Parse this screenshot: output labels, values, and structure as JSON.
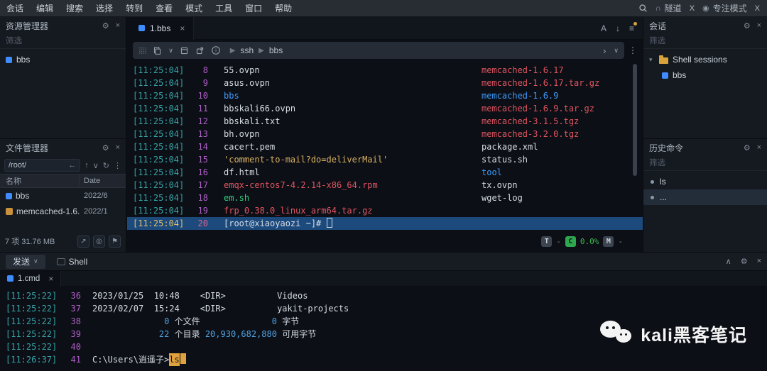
{
  "colors": {
    "accent_blue": "#3f8cff",
    "timestamp": "#36a3a8",
    "line_number": "#b05fc8",
    "file_default": "#d6dde6",
    "directory": "#3f9bfb",
    "archive": "#e05561",
    "executable": "#2fd07a",
    "quoted": "#d9b163",
    "selection_background": "#1d4a7d",
    "selected_timestamp": "#e2c06a",
    "selected_line_number": "#e0608d",
    "cpu_badge_green": "#2ea84f",
    "command_highlight": "#e0a23f",
    "folder_yellow": "#d9a33c"
  },
  "menu_bar": {
    "items": [
      "会话",
      "编辑",
      "搜索",
      "选择",
      "转到",
      "查看",
      "模式",
      "工具",
      "窗口",
      "帮助"
    ],
    "tunnel": {
      "label": "隧道",
      "close": "X"
    },
    "focus_mode": {
      "label": "专注模式",
      "close": "X"
    }
  },
  "left_panel": {
    "explorer": {
      "title": "资源管理器",
      "filter": "筛选",
      "items": [
        {
          "label": "bbs"
        }
      ]
    },
    "file_manager": {
      "title": "文件管理器",
      "path": "/root/",
      "columns": {
        "name": "名称",
        "date": "Date"
      },
      "rows": [
        {
          "name": "bbs",
          "date": "2022/6"
        },
        {
          "name": "memcached-1.6...",
          "date": "2022/1"
        }
      ],
      "status": "7 项 31.76 MB"
    }
  },
  "main": {
    "tab": {
      "label": "1.bbs",
      "close": "×"
    },
    "tab_tools": {
      "font": "A",
      "scroll": "↓",
      "menu": "≡"
    },
    "toolbar": {
      "breadcrumb": [
        "ssh",
        "bbs"
      ]
    },
    "terminal": {
      "lines": [
        {
          "time": "[11:25:04]",
          "num": "8",
          "left": "55.ovpn",
          "right": "memcached-1.6.17"
        },
        {
          "time": "[11:25:04]",
          "num": "9",
          "left": "asus.ovpn",
          "right": "memcached-1.6.17.tar.gz"
        },
        {
          "time": "[11:25:04]",
          "num": "10",
          "left": "bbs",
          "right": "memcached-1.6.9"
        },
        {
          "time": "[11:25:04]",
          "num": "11",
          "left": "bbskali66.ovpn",
          "right": "memcached-1.6.9.tar.gz"
        },
        {
          "time": "[11:25:04]",
          "num": "12",
          "left": "bbskali.txt",
          "right": "memcached-3.1.5.tgz"
        },
        {
          "time": "[11:25:04]",
          "num": "13",
          "left": "bh.ovpn",
          "right": "memcached-3.2.0.tgz"
        },
        {
          "time": "[11:25:04]",
          "num": "14",
          "left": "cacert.pem",
          "right": "package.xml"
        },
        {
          "time": "[11:25:04]",
          "num": "15",
          "left": "'comment-to-mail?do=deliverMail'",
          "right": "status.sh"
        },
        {
          "time": "[11:25:04]",
          "num": "16",
          "left": "df.html",
          "right": "tool"
        },
        {
          "time": "[11:25:04]",
          "num": "17",
          "left": "emqx-centos7-4.2.14-x86_64.rpm",
          "right": "tx.ovpn"
        },
        {
          "time": "[11:25:04]",
          "num": "18",
          "left": "em.sh",
          "right": "wget-log"
        },
        {
          "time": "[11:25:04]",
          "num": "19",
          "left": "frp_0.38.0_linux_arm64.tar.gz",
          "right": ""
        },
        {
          "time": "[11:25:04]",
          "num": "20",
          "left": "[root@xiaoyaozi ~]# ",
          "right": ""
        }
      ]
    },
    "status_bar": {
      "t_badge": "T",
      "t_value": "-",
      "c_badge": "C",
      "cpu": "0.0%",
      "m_badge": "M",
      "m_value": "-"
    }
  },
  "right_panel": {
    "sessions": {
      "title": "会话",
      "filter": "筛选",
      "tree": [
        {
          "label": "Shell sessions",
          "type": "folder"
        },
        {
          "label": "bbs",
          "type": "session"
        }
      ]
    },
    "history": {
      "title": "历史命令",
      "filter": "筛选",
      "items": [
        "ls",
        "..."
      ]
    }
  },
  "bottom_panel": {
    "tabs": [
      {
        "label": "发送"
      },
      {
        "label": "Shell"
      }
    ],
    "tab": {
      "label": "1.cmd",
      "close": "×"
    },
    "terminal": {
      "lines": [
        {
          "time": "[11:25:22]",
          "num": "36",
          "text": "2023/01/25  10:48    <DIR>          Videos"
        },
        {
          "time": "[11:25:22]",
          "num": "37",
          "text": "2023/02/07  15:24    <DIR>          yakit-projects"
        },
        {
          "time": "[11:25:22]",
          "num": "38",
          "seg1": "              0",
          "seg2": " 个文件",
          "seg3": "              0",
          "seg4": " 字节"
        },
        {
          "time": "[11:25:22]",
          "num": "39",
          "seg1": "             22",
          "seg2": " 个目录",
          "seg3": " 20,930,682,880",
          "seg4": " 可用字节"
        },
        {
          "time": "[11:25:22]",
          "num": "40",
          "text": ""
        },
        {
          "time": "[11:26:37]",
          "num": "41",
          "prompt": "C:\\Users\\逍遥子>",
          "command": "ls"
        }
      ]
    }
  },
  "watermark": {
    "text": "kali黑客笔记"
  }
}
